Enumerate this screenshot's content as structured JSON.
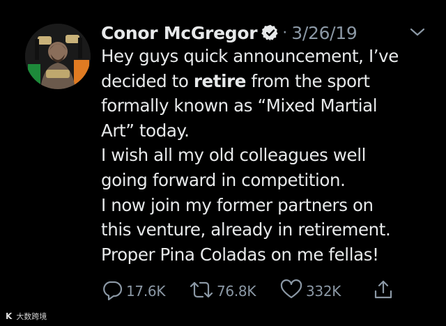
{
  "tweet": {
    "author": {
      "display_name": "Conor McGregor",
      "verified": true,
      "verified_badge_icon": "verified-badge-icon",
      "avatar_icon": "profile-photo-avatar"
    },
    "separator": "·",
    "date": "3/26/19",
    "menu_icon": "chevron-down-icon",
    "body": {
      "line1": "Hey guys quick announcement, I’ve",
      "line2_before": "decided to ",
      "line2_bold": "retire",
      "line2_after": " from the sport",
      "line3": "formally known as “Mixed Martial",
      "line4": "Art” today.",
      "line5": "I wish all my old colleagues well",
      "line6": "going forward in competition.",
      "line7": "I now join my former partners on",
      "line8": "this venture, already in retirement.",
      "line9": "Proper Pina Coladas on me fellas!"
    },
    "actions": {
      "reply_count": "17.6K",
      "retweet_count": "76.8K",
      "like_count": "332K",
      "reply_icon": "reply-icon",
      "retweet_icon": "retweet-icon",
      "like_icon": "heart-icon",
      "share_icon": "share-icon"
    }
  },
  "watermark": {
    "logo": "K",
    "text": "大数跨境"
  },
  "colors": {
    "background": "#000000",
    "text_primary": "#e7e9ea",
    "text_secondary": "#8b98a5"
  }
}
